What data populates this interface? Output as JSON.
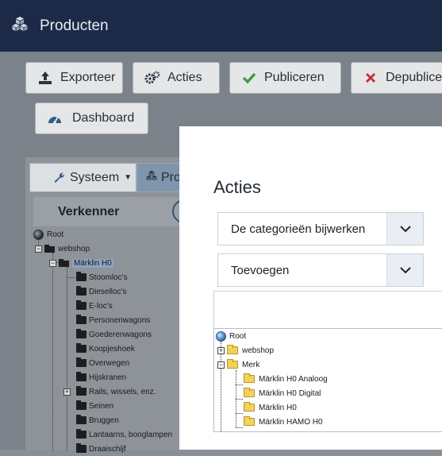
{
  "header": {
    "title": "Producten"
  },
  "toolbar": {
    "export_label": "Exporteer",
    "actions_label": "Acties",
    "publish_label": "Publiceren",
    "unpublish_label": "Depublice",
    "dashboard_label": "Dashboard"
  },
  "left": {
    "tab_system": "Systeem",
    "tab_products": "Pro",
    "explorer_title": "Verkenner",
    "tree": {
      "root": "Root",
      "webshop": "webshop",
      "marklin": "Märklin H0",
      "children": [
        "Stoomloc's",
        "Dieselloc's",
        "E-loc's",
        "Personenwagons",
        "Goederenwagons",
        "Koopjeshoek",
        "Overwegen",
        "Hijskranen",
        "Rails, wissels, enz.",
        "Seinen",
        "Bruggen",
        "Lantaarns, booglampen",
        "Draaischijf"
      ]
    }
  },
  "modal": {
    "title": "Acties",
    "select_action": "De categorieën bijwerken",
    "select_mode": "Toevoegen",
    "tree": {
      "root": "Root",
      "webshop": "webshop",
      "merk": "Merk",
      "merk_children": [
        "Märklin H0 Analoog",
        "Märklin H0 Digital",
        "Märklin H0",
        "Märklin HAMO H0"
      ]
    }
  },
  "colors": {
    "header_bg": "#1c2a48",
    "publish_check": "#3a9a3a",
    "unpublish_x": "#c43030",
    "accent": "#2f5b86"
  }
}
